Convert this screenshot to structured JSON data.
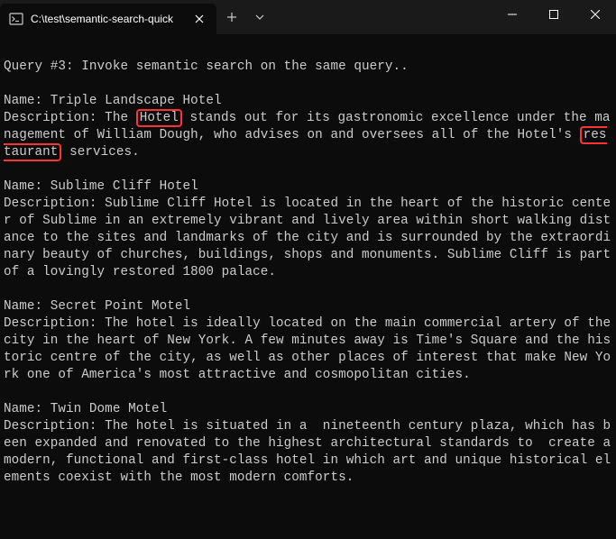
{
  "titleBar": {
    "tabTitle": "C:\\test\\semantic-search-quick",
    "closeLabel": "✕",
    "newTabLabel": "+",
    "dropdownLabel": "⌄",
    "minimizeLabel": "—",
    "maximizeLabel": "▢",
    "windowCloseLabel": "✕"
  },
  "terminal": {
    "queryHeader": "Query #3: Invoke semantic search on the same query..",
    "results": [
      {
        "nameLabel": "Name: Triple Landscape Hotel",
        "descPrefix": "Description: The",
        "highlight1": "Hotel",
        "descMid": "stands out for its gastronomic excellence under the management of William Dough, who advises on and oversees all of the Hotel's",
        "highlight2": "restaurant",
        "descSuffix": "services."
      },
      {
        "nameLabel": "Name: Sublime Cliff Hotel",
        "description": "Description: Sublime Cliff Hotel is located in the heart of the historic center of Sublime in an extremely vibrant and lively area within short walking distance to the sites and landmarks of the city and is surrounded by the extraordinary beauty of churches, buildings, shops and monuments. Sublime Cliff is part of a lovingly restored 1800 palace."
      },
      {
        "nameLabel": "Name: Secret Point Motel",
        "description": "Description: The hotel is ideally located on the main commercial artery of the city in the heart of New York. A few minutes away is Time's Square and the historic centre of the city, as well as other places of interest that make New York one of America's most attractive and cosmopolitan cities."
      },
      {
        "nameLabel": "Name: Twin Dome Motel",
        "description": "Description: The hotel is situated in a  nineteenth century plaza, which has been expanded and renovated to the highest architectural standards to  create a modern, functional and first-class hotel in which art and unique historical elements coexist with the most modern comforts."
      }
    ]
  }
}
